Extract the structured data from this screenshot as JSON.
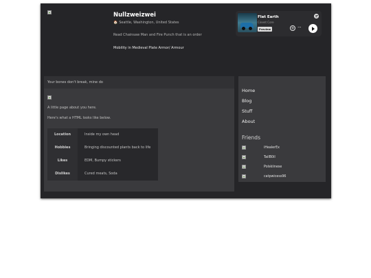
{
  "profile": {
    "name": "Nullzweizwei",
    "location": "Seattle, Washington, United States",
    "location_icon": "home-icon",
    "bio_line_1": "Read Chainsaw Man and Fire Punch that is an order",
    "bio_line_2": "Mobility in Medieval Plate Armor/ Armour"
  },
  "spotify": {
    "track_title": "Flat Earth",
    "artist": "Cinent Core",
    "preview_label": "Preview",
    "add_icon": "+",
    "more_icon": "···"
  },
  "main": {
    "header": "Your bones don't break, mine do",
    "intro": "A little page about you here.",
    "table_intro": "Here's what a HTML looks like below.",
    "table": [
      {
        "label": "Location",
        "value": "Inside my own head"
      },
      {
        "label": "Hobbies",
        "value": "Bringing discounted plants back to life"
      },
      {
        "label": "Likes",
        "value": "EDM, Bumpy stickers"
      },
      {
        "label": "Dislikes",
        "value": "Cured meats, Soda"
      }
    ]
  },
  "sidebar": {
    "nav": [
      "Home",
      "Blog",
      "Stuff",
      "About"
    ],
    "friends_heading": "Friends",
    "friends": [
      "iHealerEx",
      "TailB0iI",
      "Polskiinese",
      "catpwicess96"
    ]
  },
  "colors": {
    "frame_bg": "#252528",
    "panel_bg": "#3a3a3d",
    "play_button": "#ffffff"
  }
}
